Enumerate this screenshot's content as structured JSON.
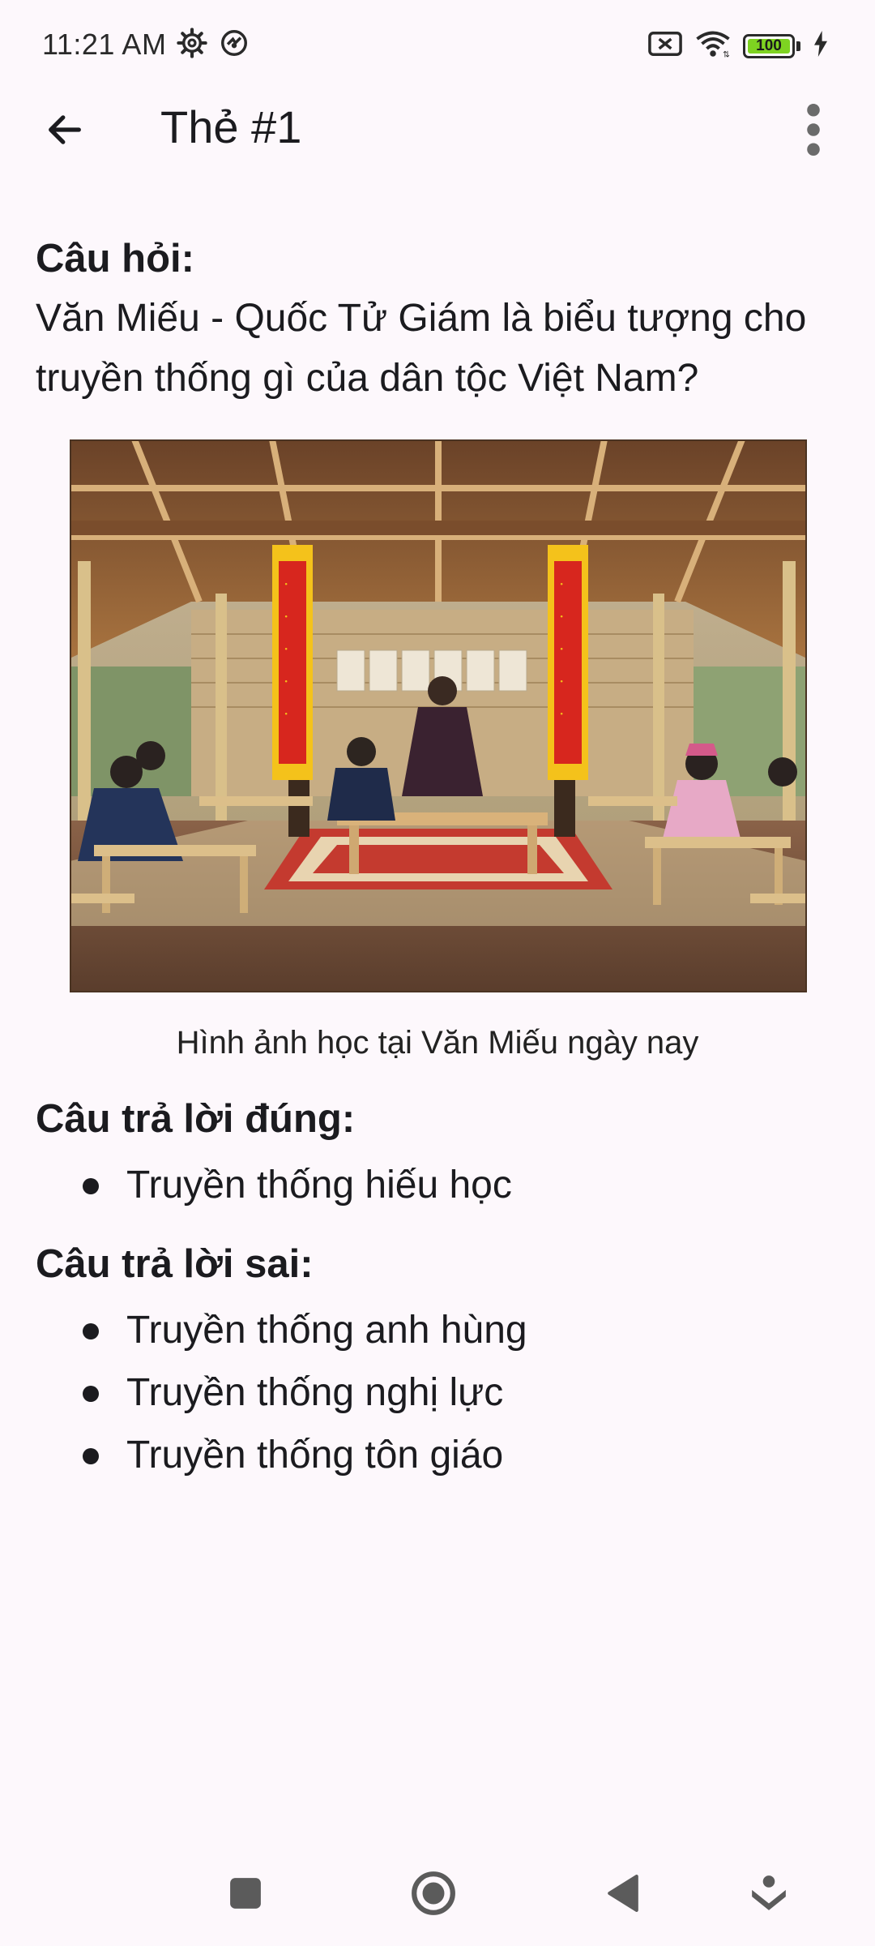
{
  "status_bar": {
    "time": "11:21 AM",
    "battery": "100",
    "icons": [
      "settings-icon",
      "vpn-icon",
      "no-sim-icon",
      "wifi-icon",
      "battery-icon",
      "charging-icon"
    ]
  },
  "app_bar": {
    "title": "Thẻ #1",
    "icons": [
      "back-arrow-icon",
      "more-vert-icon"
    ]
  },
  "question": {
    "heading": "Câu hỏi:",
    "text": "Văn Miếu - Quốc Tử Giám là biểu tượng cho truyền thống gì của dân tộc Việt Nam?"
  },
  "figure": {
    "caption": "Hình ảnh học tại Văn Miếu ngày nay"
  },
  "correct_answers": {
    "heading": "Câu trả lời đúng:",
    "items": [
      "Truyền thống hiếu học"
    ]
  },
  "wrong_answers": {
    "heading": "Câu trả lời sai:",
    "items": [
      "Truyền thống anh hùng",
      "Truyền thống nghị lực",
      "Truyền thống tôn giáo"
    ]
  },
  "nav_bar": {
    "icons": [
      "recents-icon",
      "home-icon",
      "back-icon",
      "assistant-icon"
    ]
  },
  "colors": {
    "background": "#fdf8fc",
    "text": "#1b1b1f",
    "battery_fill": "#7ed321",
    "banner_red": "#d7261e",
    "banner_yellow": "#f4c21b"
  }
}
